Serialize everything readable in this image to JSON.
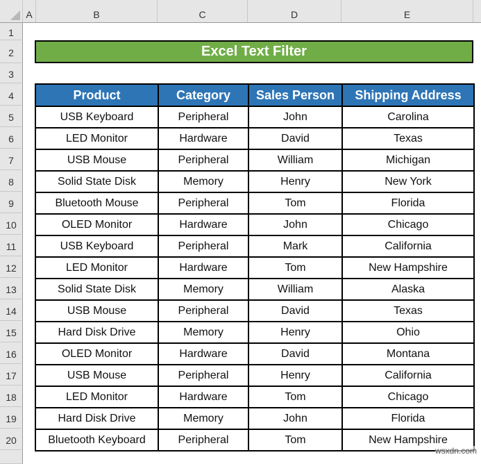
{
  "sheet": {
    "columns": [
      "A",
      "B",
      "C",
      "D",
      "E"
    ],
    "rows": [
      "1",
      "2",
      "3",
      "4",
      "5",
      "6",
      "7",
      "8",
      "9",
      "10",
      "11",
      "12",
      "13",
      "14",
      "15",
      "16",
      "17",
      "18",
      "19",
      "20"
    ]
  },
  "title": "Excel Text Filter",
  "table": {
    "headers": [
      "Product",
      "Category",
      "Sales Person",
      "Shipping Address"
    ],
    "rows": [
      [
        "USB Keyboard",
        "Peripheral",
        "John",
        "Carolina"
      ],
      [
        "LED Monitor",
        "Hardware",
        "David",
        "Texas"
      ],
      [
        "USB Mouse",
        "Peripheral",
        "William",
        "Michigan"
      ],
      [
        "Solid State Disk",
        "Memory",
        "Henry",
        "New York"
      ],
      [
        "Bluetooth Mouse",
        "Peripheral",
        "Tom",
        "Florida"
      ],
      [
        "OLED Monitor",
        "Hardware",
        "John",
        "Chicago"
      ],
      [
        "USB Keyboard",
        "Peripheral",
        "Mark",
        "California"
      ],
      [
        "LED Monitor",
        "Hardware",
        "Tom",
        "New Hampshire"
      ],
      [
        "Solid State Disk",
        "Memory",
        "William",
        "Alaska"
      ],
      [
        "USB Mouse",
        "Peripheral",
        "David",
        "Texas"
      ],
      [
        "Hard Disk Drive",
        "Memory",
        "Henry",
        "Ohio"
      ],
      [
        "OLED Monitor",
        "Hardware",
        "David",
        "Montana"
      ],
      [
        "USB Mouse",
        "Peripheral",
        "Henry",
        "California"
      ],
      [
        "LED Monitor",
        "Hardware",
        "Tom",
        "Chicago"
      ],
      [
        "Hard Disk Drive",
        "Memory",
        "John",
        "Florida"
      ],
      [
        "Bluetooth Keyboard",
        "Peripheral",
        "Tom",
        "New Hampshire"
      ]
    ]
  },
  "colors": {
    "title_bg": "#70ad47",
    "header_bg": "#2e75b6"
  },
  "watermark": "wsxdn.com"
}
